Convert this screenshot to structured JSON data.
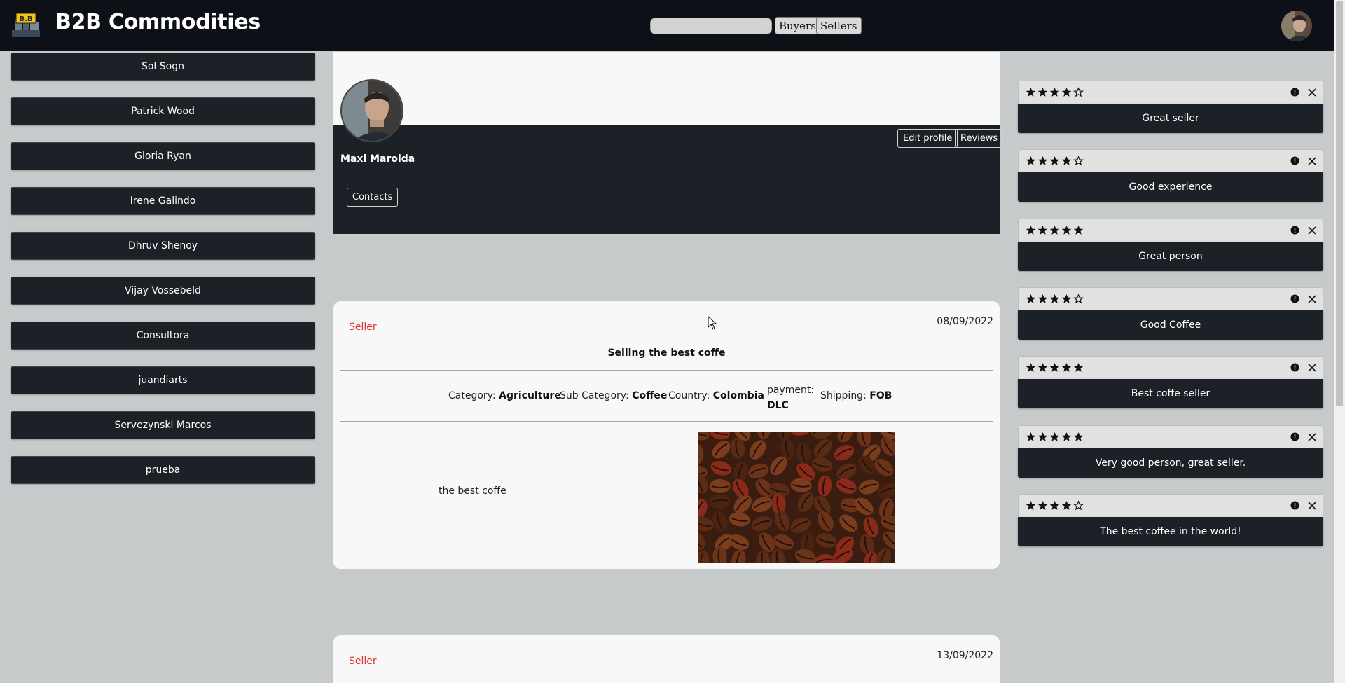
{
  "brand": {
    "logo_text": "B.B",
    "title": "B2B Commodities"
  },
  "search": {
    "placeholder": ""
  },
  "nav": {
    "buyers_label": "Buyers",
    "sellers_label": "Sellers"
  },
  "contacts": [
    "Sol Sogn",
    "Patrick Wood",
    "Gloria Ryan",
    "Irene Galindo",
    "Dhruv Shenoy",
    "Vijay Vossebeld",
    "Consultora",
    "juandiarts",
    "Servezynski Marcos",
    "prueba"
  ],
  "profile": {
    "name": "Maxi Marolda",
    "edit_label": "Edit profile",
    "reviews_label": "Reviews",
    "contacts_label": "Contacts"
  },
  "posts": [
    {
      "role": "Seller",
      "date": "08/09/2022",
      "title": "Selling the best coffe",
      "category_label": "Category:",
      "category": "Agriculture",
      "subcategory_label": "Sub Category:",
      "subcategory": "Coffee",
      "country_label": "Country:",
      "country": "Colombia",
      "payment_label": "payment:",
      "payment": "DLC",
      "shipping_label": "Shipping:",
      "shipping": "FOB",
      "description": "the best coffe",
      "image": "coffee-beans-photo"
    },
    {
      "role": "Seller",
      "date": "13/09/2022"
    }
  ],
  "reviews": [
    {
      "rating": 4,
      "text": "Great seller"
    },
    {
      "rating": 4,
      "text": "Good experience"
    },
    {
      "rating": 5,
      "text": "Great person"
    },
    {
      "rating": 4,
      "text": "Good Coffee"
    },
    {
      "rating": 5,
      "text": "Best coffe seller"
    },
    {
      "rating": 5,
      "text": "Very good person, great seller."
    },
    {
      "rating": 4,
      "text": "The best coffee in the world!"
    }
  ],
  "colors": {
    "navbar": "#0d1117",
    "dark_panel": "#1b2126",
    "page_bg": "#c6cacb",
    "seller_red": "#e0352b"
  }
}
